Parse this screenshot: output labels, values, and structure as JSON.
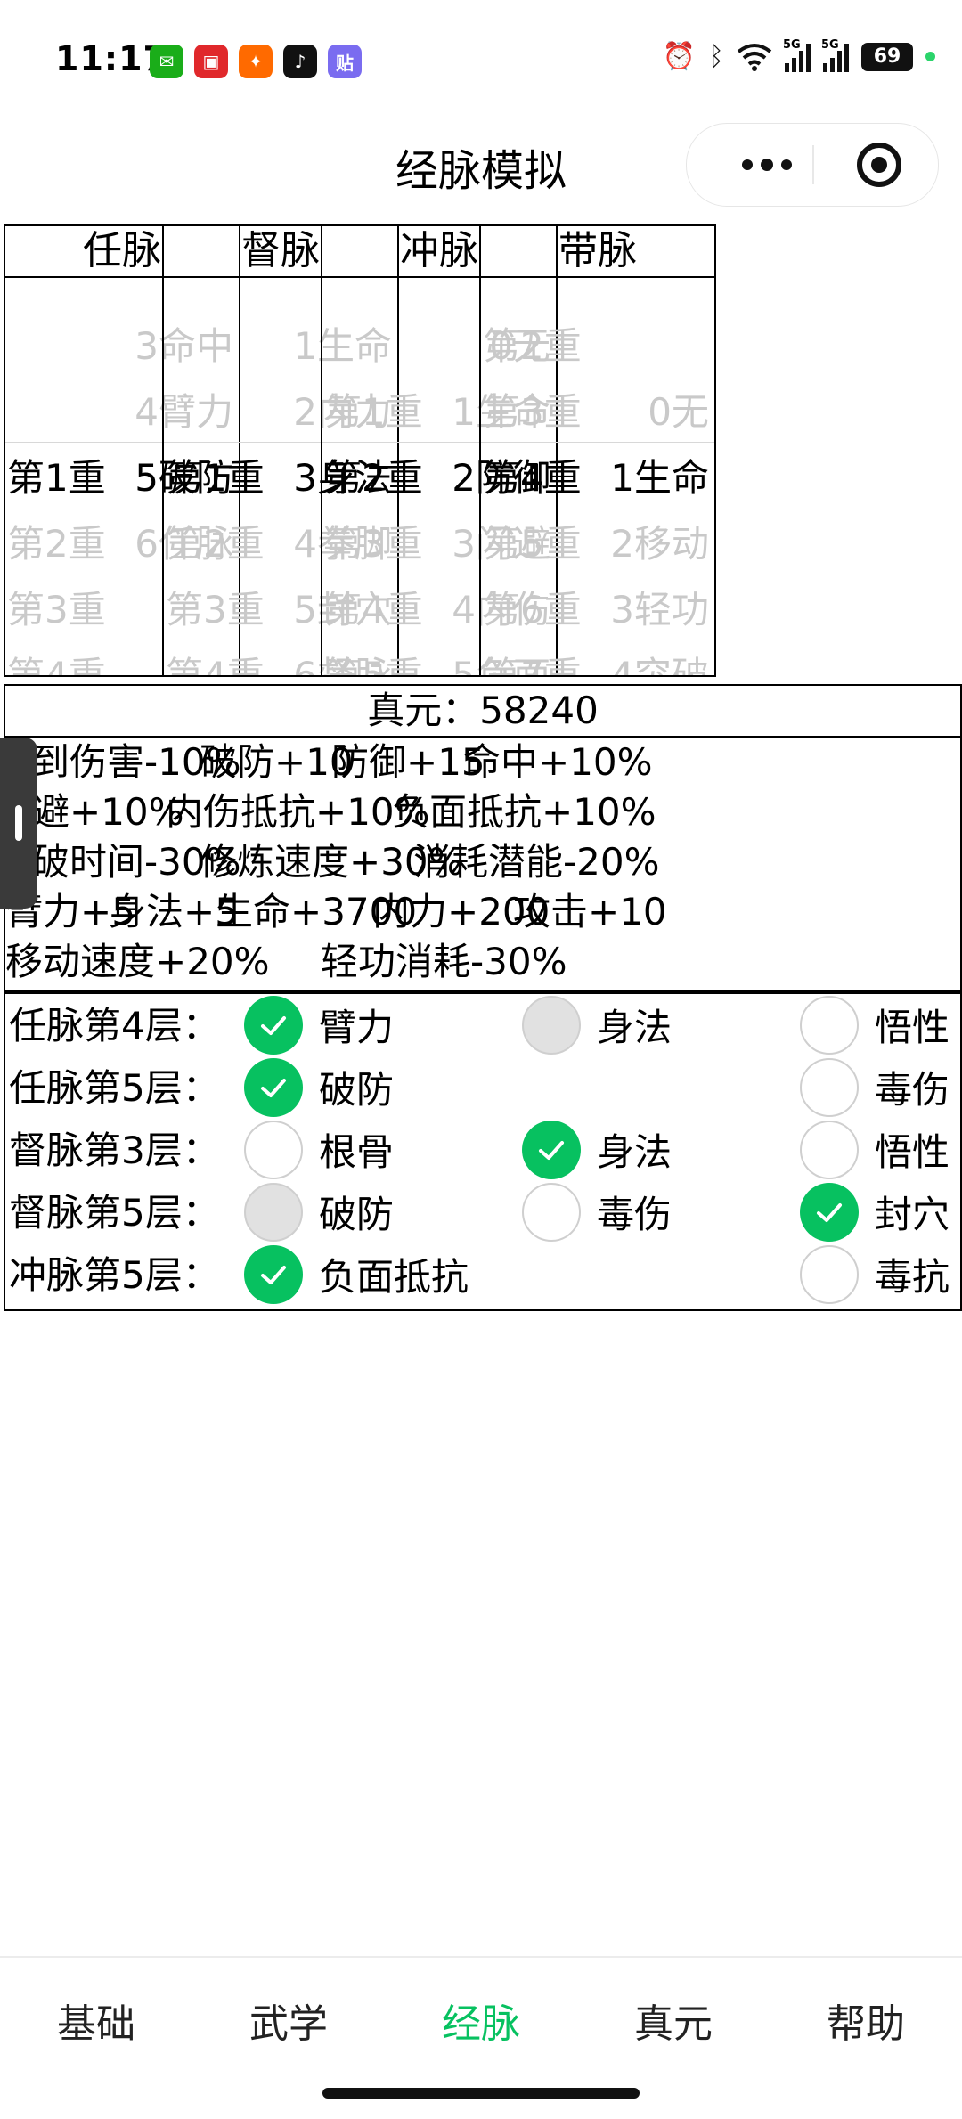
{
  "status_bar": {
    "time": "11:17",
    "battery": "69",
    "signal_labels": [
      "5G",
      "5G"
    ],
    "app_icons": [
      {
        "name": "wechat-icon",
        "color": "#1aad19",
        "glyph": "✉"
      },
      {
        "name": "calendar-icon",
        "color": "#e0282b",
        "glyph": "▣"
      },
      {
        "name": "dianping-icon",
        "color": "#ff6a00",
        "glyph": "✦"
      },
      {
        "name": "douyin-icon",
        "color": "#111111",
        "glyph": "♪"
      },
      {
        "name": "tieba-icon",
        "color": "#7a6cf0",
        "glyph": "贴"
      }
    ]
  },
  "nav": {
    "title": "经脉模拟"
  },
  "pickers": [
    {
      "header": "任脉",
      "rows": [
        {
          "left": "",
          "right": "3命中",
          "faded": true
        },
        {
          "left": "",
          "right": "4臂力",
          "faded": true
        },
        {
          "left": "第1重",
          "right": "5破防",
          "faded": false
        },
        {
          "left": "第2重",
          "right": "6任脉",
          "faded": true
        },
        {
          "left": "第3重",
          "right": "",
          "faded": true
        },
        {
          "left": "第4重",
          "right": "",
          "faded": true
        }
      ]
    },
    {
      "header": "督脉",
      "rows": [
        {
          "left": "",
          "right": "1生命",
          "faded": true
        },
        {
          "left": "",
          "right": "2内力",
          "faded": true
        },
        {
          "left": "第1重",
          "right": "3身法",
          "faded": false
        },
        {
          "left": "第2重",
          "right": "4拳脚",
          "faded": true
        },
        {
          "left": "第3重",
          "right": "5封穴",
          "faded": true
        },
        {
          "left": "第4重",
          "right": "6督脉",
          "faded": true
        }
      ]
    },
    {
      "header": "冲脉",
      "rows": [
        {
          "left": "",
          "right": "0无",
          "faded": true
        },
        {
          "left": "第1重",
          "right": "1生命",
          "faded": true
        },
        {
          "left": "第2重",
          "right": "2防御",
          "faded": false
        },
        {
          "left": "第3重",
          "right": "3闪避",
          "faded": true
        },
        {
          "left": "第4重",
          "right": "4内伤",
          "faded": true
        },
        {
          "left": "第5重",
          "right": "5负面",
          "faded": true
        }
      ]
    },
    {
      "header": "带脉",
      "rows": [
        {
          "left": "第2重",
          "right": "",
          "faded": true
        },
        {
          "left": "第3重",
          "right": "0无",
          "faded": true
        },
        {
          "left": "第4重",
          "right": "1生命",
          "faded": false
        },
        {
          "left": "第5重",
          "right": "2移动",
          "faded": true
        },
        {
          "left": "第6重",
          "right": "3轻功",
          "faded": true
        },
        {
          "left": "第7重",
          "right": "4突破",
          "faded": true
        }
      ]
    }
  ],
  "zhenyuan": {
    "label": "真元：",
    "value": "58240"
  },
  "attributes": [
    [
      "受到伤害-10%",
      "破防+10",
      "防御+15",
      "命中+10%"
    ],
    [
      "闪避+10%",
      "内伤抵抗+10%",
      "负面抵抗+10%"
    ],
    [
      "突破时间-30%",
      "修炼速度+30%",
      "消耗潜能-20%"
    ],
    [
      "臂力+5",
      "身法+5",
      "生命+3700",
      "内力+200",
      "攻击+10"
    ],
    [
      "移动速度+20%",
      "轻功消耗-30%"
    ]
  ],
  "options": [
    {
      "label": "任脉第4层：",
      "items": [
        {
          "text": "臂力",
          "state": "checked"
        },
        {
          "text": "身法",
          "state": "disabled"
        },
        {
          "text": "悟性",
          "state": "unchecked"
        }
      ]
    },
    {
      "label": "任脉第5层：",
      "items": [
        {
          "text": "破防",
          "state": "checked"
        },
        null,
        {
          "text": "毒伤",
          "state": "unchecked"
        }
      ]
    },
    {
      "label": "督脉第3层：",
      "items": [
        {
          "text": "根骨",
          "state": "unchecked"
        },
        {
          "text": "身法",
          "state": "checked"
        },
        {
          "text": "悟性",
          "state": "unchecked"
        }
      ]
    },
    {
      "label": "督脉第5层：",
      "items": [
        {
          "text": "破防",
          "state": "disabled"
        },
        {
          "text": "毒伤",
          "state": "unchecked"
        },
        {
          "text": "封穴",
          "state": "checked"
        }
      ]
    },
    {
      "label": "冲脉第5层：",
      "items": [
        {
          "text": "负面抵抗",
          "state": "checked"
        },
        null,
        {
          "text": "毒抗",
          "state": "unchecked"
        }
      ]
    }
  ],
  "tabs": [
    {
      "label": "基础",
      "active": false
    },
    {
      "label": "武学",
      "active": false
    },
    {
      "label": "经脉",
      "active": true
    },
    {
      "label": "真元",
      "active": false
    },
    {
      "label": "帮助",
      "active": false
    }
  ],
  "colors": {
    "accent": "#07c160",
    "faded_text": "#c9c9c9"
  }
}
